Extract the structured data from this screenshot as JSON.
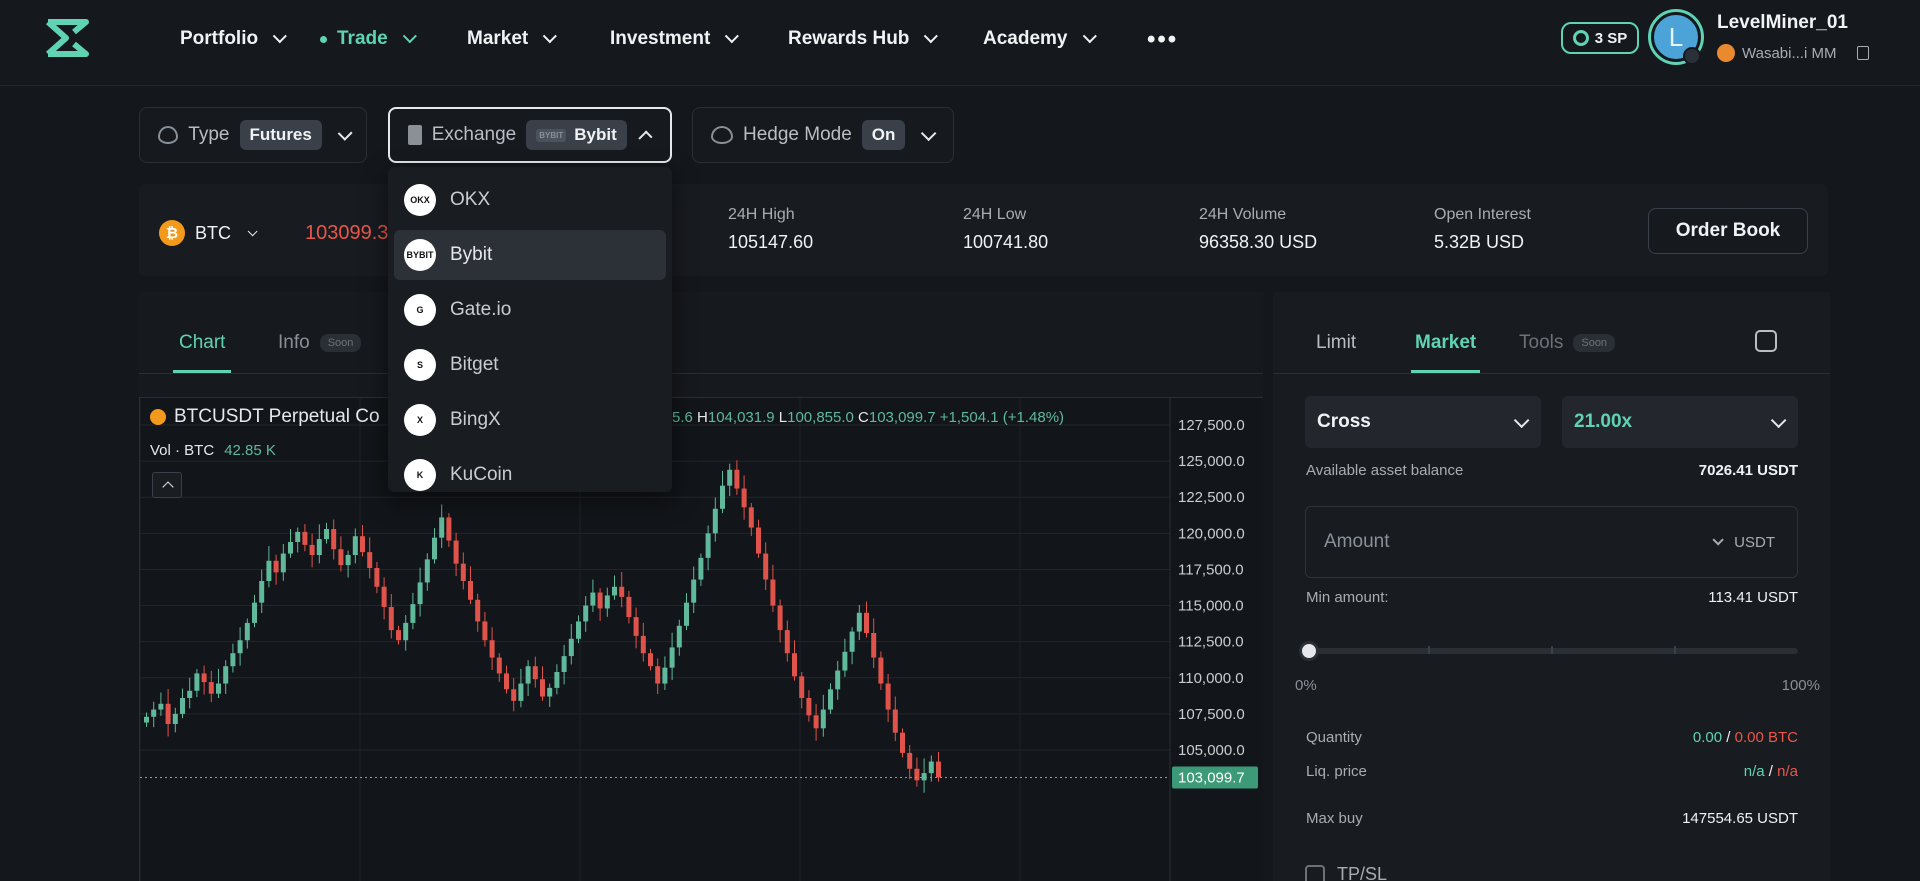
{
  "nav": {
    "items": [
      {
        "label": "Portfolio",
        "active": false
      },
      {
        "label": "Trade",
        "active": true
      },
      {
        "label": "Market",
        "active": false
      },
      {
        "label": "Investment",
        "active": false
      },
      {
        "label": "Rewards Hub",
        "active": false
      },
      {
        "label": "Academy",
        "active": false
      }
    ],
    "more": "•••",
    "sp_badge": "3 SP",
    "avatar_initial": "L",
    "username": "LevelMiner_01",
    "wallet": "Wasabi...i MM"
  },
  "filters": {
    "type": {
      "label": "Type",
      "value": "Futures"
    },
    "exchange": {
      "label": "Exchange",
      "value": "Bybit",
      "logo": "BYBIT"
    },
    "hedge": {
      "label": "Hedge Mode",
      "value": "On"
    }
  },
  "exchange_dropdown": {
    "items": [
      {
        "label": "OKX",
        "selected": false,
        "logo_text": "OKX"
      },
      {
        "label": "Bybit",
        "selected": true,
        "logo_text": "BYBIT"
      },
      {
        "label": "Gate.io",
        "selected": false,
        "logo_text": "G"
      },
      {
        "label": "Bitget",
        "selected": false,
        "logo_text": "S"
      },
      {
        "label": "BingX",
        "selected": false,
        "logo_text": "X"
      },
      {
        "label": "KuCoin",
        "selected": false,
        "logo_text": "K"
      }
    ]
  },
  "ticker": {
    "symbol": "BTC",
    "price": "103099.3",
    "stats": [
      {
        "label": "24H High",
        "value": "105147.60"
      },
      {
        "label": "24H Low",
        "value": "100741.80"
      },
      {
        "label": "24H Volume",
        "value": "96358.30 USD"
      },
      {
        "label": "Open Interest",
        "value": "5.32B USD"
      }
    ],
    "order_book": "Order Book"
  },
  "chart_tabs": {
    "chart": "Chart",
    "info": "Info",
    "soon": "Soon"
  },
  "chart_data": {
    "type": "candlestick",
    "title": "BTCUSDT Perpetual Co",
    "ohlc_text": {
      "o_tail": "5.6",
      "h": "104,031.9",
      "l": "100,855.0",
      "c": "103,099.7",
      "change": "+1,504.1 (+1.48%)"
    },
    "volume_label": "Vol · BTC",
    "volume_value": "42.85 K",
    "y_ticks": [
      "127,500.0",
      "125,000.0",
      "122,500.0",
      "120,000.0",
      "117,500.0",
      "115,000.0",
      "112,500.0",
      "110,000.0",
      "107,500.0",
      "105,000.0"
    ],
    "y_tick_values": [
      127500,
      125000,
      122500,
      120000,
      117500,
      115000,
      112500,
      110000,
      107500,
      105000
    ],
    "ylim": [
      101500,
      129000
    ],
    "last_price_label": "103,099.7",
    "last_price": 103099.7,
    "up_color": "#5fb99a",
    "down_color": "#e0534a",
    "closes": [
      107300,
      107800,
      108200,
      106800,
      107500,
      108600,
      109100,
      110300,
      109700,
      108900,
      109600,
      110800,
      111700,
      112600,
      113800,
      115200,
      116700,
      118100,
      117300,
      118600,
      119400,
      120100,
      119200,
      118500,
      119600,
      120300,
      118900,
      117800,
      118500,
      119800,
      118700,
      117600,
      116300,
      114900,
      113300,
      112600,
      113800,
      115100,
      116600,
      118200,
      119700,
      121100,
      119500,
      117900,
      116700,
      115400,
      113900,
      112600,
      111400,
      110300,
      109200,
      108400,
      109600,
      110800,
      109900,
      108700,
      109300,
      110400,
      111500,
      112700,
      113900,
      115000,
      115900,
      114800,
      115700,
      116300,
      115600,
      114200,
      112900,
      111700,
      110800,
      109600,
      110700,
      112100,
      113600,
      115200,
      116800,
      118300,
      120000,
      121700,
      123300,
      124400,
      123100,
      121800,
      120400,
      118600,
      116800,
      115000,
      113300,
      111700,
      110100,
      108600,
      107400,
      106500,
      107800,
      109200,
      110500,
      111800,
      113200,
      114500,
      113100,
      111400,
      109600,
      107800,
      106200,
      104800,
      103700,
      102900,
      103400,
      104200,
      103100
    ]
  },
  "order_panel": {
    "tabs": {
      "limit": "Limit",
      "market": "Market",
      "tools": "Tools",
      "soon": "Soon"
    },
    "margin_mode": "Cross",
    "leverage": "21.00x",
    "available_label": "Available asset balance",
    "available_value": "7026.41 USDT",
    "amount_placeholder": "Amount",
    "amount_unit": "USDT",
    "min_label": "Min amount:",
    "min_value": "113.41 USDT",
    "slider_value_pct": 0,
    "pct_min": "0%",
    "pct_max": "100%",
    "quantity_label": "Quantity",
    "quantity_a": "0.00",
    "quantity_sep": "/",
    "quantity_b": "0.00 BTC",
    "liq_label": "Liq. price",
    "liq_a": "n/a",
    "liq_sep": "/",
    "liq_b": "n/a",
    "maxbuy_label": "Max buy",
    "maxbuy_value": "147554.65 USDT",
    "tpsl_label": "TP/SL"
  }
}
